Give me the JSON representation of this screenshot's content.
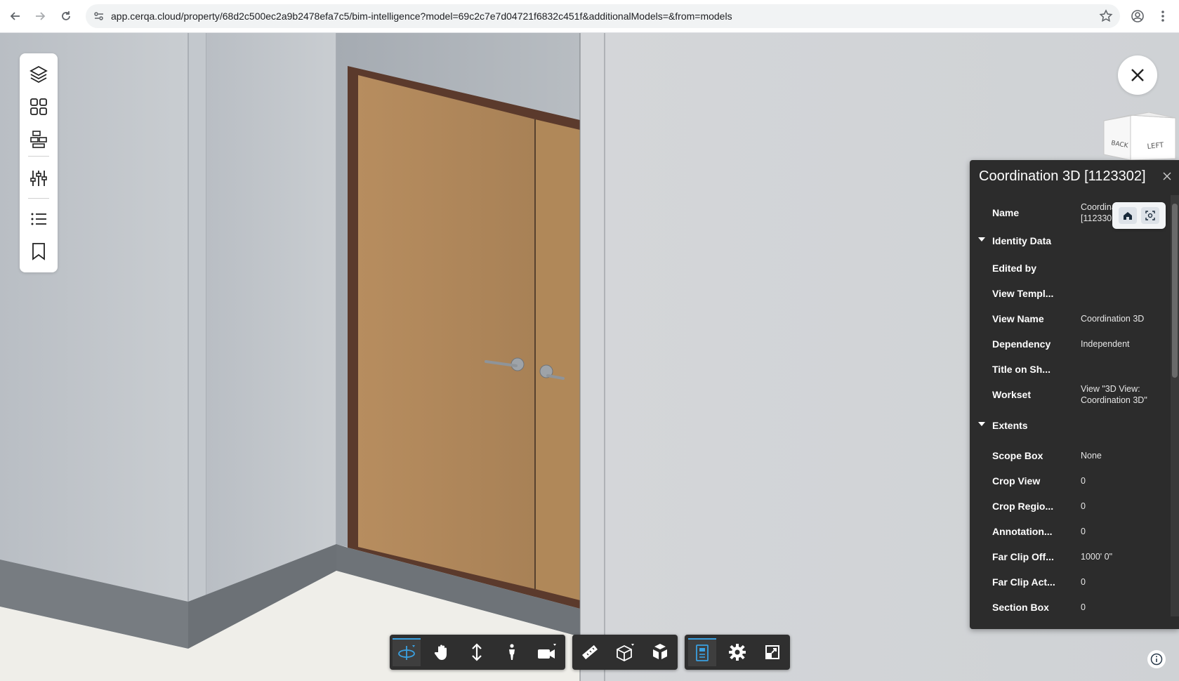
{
  "browser": {
    "url": "app.cerqa.cloud/property/68d2c500ec2a9b2478efa7c5/bim-intelligence?model=69c2c7e7d04721f6832c451f&additionalModels=&from=models",
    "icons": [
      "back-arrow-icon",
      "forward-arrow-icon",
      "reload-icon",
      "site-info-icon",
      "bookmark-star-icon",
      "profile-icon",
      "kebab-menu-icon"
    ]
  },
  "left_toolbar": {
    "icons": [
      "layers-icon",
      "grid-icon",
      "model-tree-icon",
      "sliders-icon",
      "list-icon",
      "bookmark-icon"
    ]
  },
  "view_cube": {
    "faces": [
      "BACK",
      "LEFT"
    ]
  },
  "properties": {
    "title": "Coordination 3D [1123302]",
    "rows": [
      {
        "type": "prop",
        "name": "Name",
        "value": "Coordination 3D [1123302]"
      },
      {
        "type": "group",
        "name": "Identity Data"
      },
      {
        "type": "prop",
        "name": "Edited by",
        "value": ""
      },
      {
        "type": "prop",
        "name": "View Templ...",
        "value": ""
      },
      {
        "type": "prop",
        "name": "View Name",
        "value": "Coordination 3D"
      },
      {
        "type": "prop",
        "name": "Dependency",
        "value": "Independent"
      },
      {
        "type": "prop",
        "name": "Title on Sh...",
        "value": ""
      },
      {
        "type": "prop",
        "name": "Workset",
        "value": "View \"3D View: Coordination 3D\""
      },
      {
        "type": "group",
        "name": "Extents"
      },
      {
        "type": "prop",
        "name": "Scope Box",
        "value": "None"
      },
      {
        "type": "prop",
        "name": "Crop View",
        "value": "0"
      },
      {
        "type": "prop",
        "name": "Crop Regio...",
        "value": "0"
      },
      {
        "type": "prop",
        "name": "Annotation...",
        "value": "0"
      },
      {
        "type": "prop",
        "name": "Far Clip Off...",
        "value": "1000' 0\""
      },
      {
        "type": "prop",
        "name": "Far Clip Act...",
        "value": "0"
      },
      {
        "type": "prop",
        "name": "Section Box",
        "value": "0"
      }
    ]
  },
  "bottom_toolbar": {
    "groups": [
      [
        "orbit-icon",
        "pan-hand-icon",
        "zoom-icon",
        "first-person-icon",
        "camera-icon"
      ],
      [
        "measure-icon",
        "section-box-icon",
        "explode-icon"
      ],
      [
        "model-browser-icon",
        "settings-gear-icon",
        "fullscreen-icon"
      ]
    ],
    "active": "orbit-icon",
    "accent": "#3aa0e0"
  }
}
